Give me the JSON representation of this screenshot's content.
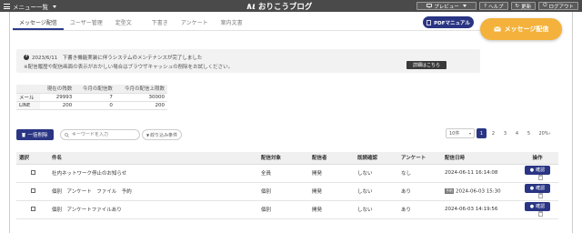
{
  "topbar": {
    "menu_label": "メニュー一覧",
    "app_title": "おりこうブログ",
    "preview_label": "プレビュー",
    "help_label": "ヘルプ",
    "refresh_label": "更新",
    "logout_label": "ログアウト"
  },
  "tabs": [
    "メッセージ配信",
    "ユーザー管理",
    "定型文",
    "下書き",
    "アンケート",
    "案内文書"
  ],
  "buttons": {
    "pdf_manual": "PDFマニュアル",
    "message_send": "メッセージ配信",
    "notice_detail": "詳細はこちら",
    "bulk_delete": "一括削除",
    "filter": "絞り込み条件"
  },
  "notice": {
    "line1": "2023/6/11　下書き機能実装に伴うシステムのメンテナンスが完了しました",
    "line2": "※配信履歴や配信画面の表示がおかしい場合はブラウザキャッシュの削除をお試しください。"
  },
  "stats": {
    "headers": [
      "現在の残数",
      "今月の配信数",
      "今月の配信上限数"
    ],
    "rows": [
      {
        "label": "メール",
        "values": [
          "29993",
          "7",
          "30000"
        ]
      },
      {
        "label": "LINE",
        "values": [
          "200",
          "0",
          "200"
        ]
      }
    ]
  },
  "search": {
    "placeholder": "キーワードを入力"
  },
  "pagination": {
    "per_page": "10件",
    "pages": [
      "1",
      "2",
      "3",
      "4",
      "5"
    ],
    "next": "20%",
    "current": "1"
  },
  "list": {
    "headers": [
      "選択",
      "件名",
      "配信対象",
      "配信者",
      "既読確認",
      "アンケート",
      "配信日時",
      "操作"
    ],
    "confirm_label": "確認",
    "rows": [
      {
        "subject": "社内ネットワーク停止のお知らせ",
        "target": "全員",
        "sender": "開発",
        "read_check": "しない",
        "survey": "なし",
        "tag": "",
        "datetime": "2024-06-11 16:14:08"
      },
      {
        "subject": "個別　アンケート　ファイル　予約",
        "target": "個別",
        "sender": "開発",
        "read_check": "しない",
        "survey": "あり",
        "tag": "予約",
        "datetime": "2024-06-03 15:30"
      },
      {
        "subject": "個別　アンケートファイルあり",
        "target": "個別",
        "sender": "開発",
        "read_check": "しない",
        "survey": "あり",
        "tag": "",
        "datetime": "2024-06-03 14:19:56"
      }
    ]
  },
  "colors": {
    "primary": "#2a3584",
    "accent": "#f4b23c",
    "topbar": "#4a4a4a"
  }
}
